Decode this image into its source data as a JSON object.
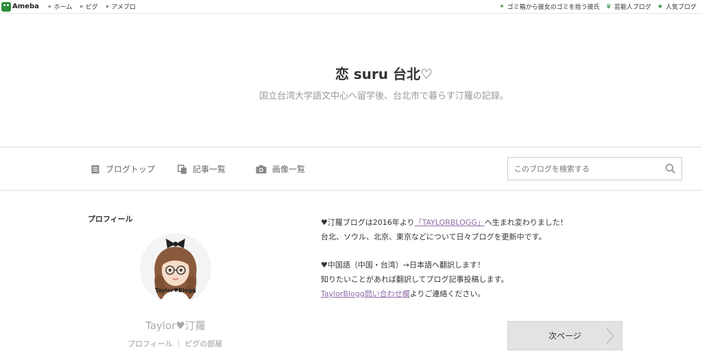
{
  "topbar": {
    "logo_text": "Ameba",
    "nav": [
      "ホーム",
      "ピグ",
      "アメブロ"
    ],
    "right_links": [
      "ゴミ箱から彼女のゴミを拾う彼氏",
      "芸能人ブログ",
      "人気ブログ"
    ]
  },
  "header": {
    "title": "恋 suru 台北♡",
    "description": "国立台湾大学語文中心へ留学後、台北市で暮らす汀羅の記録。"
  },
  "nav": {
    "items": [
      "ブログトップ",
      "記事一覧",
      "画像一覧"
    ],
    "search_placeholder": "このブログを検索する"
  },
  "profile": {
    "heading": "プロフィール",
    "avatar_caption": "Taylor♥Blogg",
    "name": "Taylor♥汀羅",
    "links": [
      "プロフィール",
      "ピグの部屋"
    ]
  },
  "message": {
    "p1_pre": "♥汀羅ブログは2016年より",
    "p1_link": "「TAYLORBLOGG」",
    "p1_post": "へ生まれ変わりました！",
    "p2": "台北、ソウル、北京、東京などについて日々ブログを更新中です。",
    "p3": "♥中国語（中国・台湾）→日本語へ翻訳します！",
    "p4": "知りたいことがあれば翻訳してブログ記事投稿します。",
    "p5_link": "TaylorBlogg問い合わせ欄",
    "p5_post": "よりご連絡ください。"
  },
  "next_label": "次ページ"
}
